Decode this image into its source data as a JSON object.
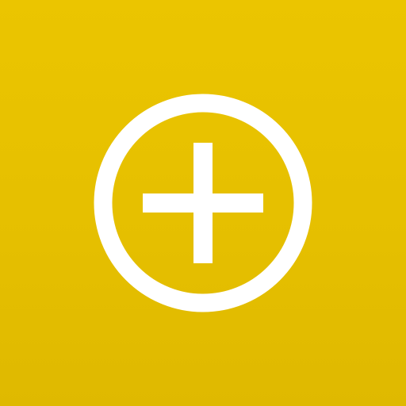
{
  "app_tile": {
    "icon": "circle-plus-icon",
    "background_color": "#e8c200",
    "foreground_color": "#ffffff"
  }
}
